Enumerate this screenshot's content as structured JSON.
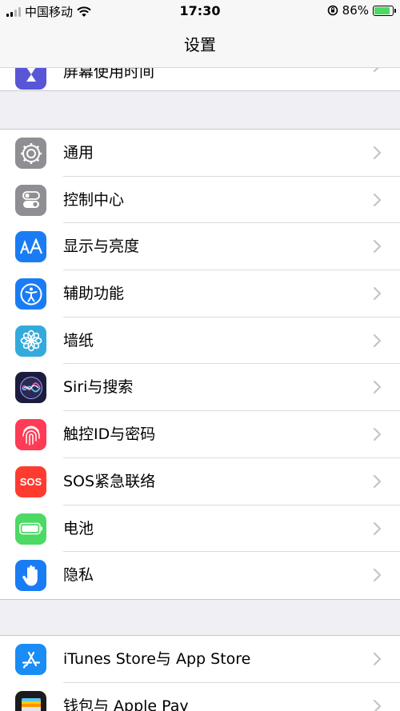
{
  "status": {
    "carrier": "中国移动",
    "time": "17:30",
    "battery": "86%",
    "battery_level": 0.86
  },
  "nav": {
    "title": "设置"
  },
  "partial": {
    "label": "屏幕使用时间",
    "icon": "hourglass-icon",
    "color": "#5856d6"
  },
  "group1": [
    {
      "label": "通用",
      "icon": "gear-icon",
      "color": "#8e8e93"
    },
    {
      "label": "控制中心",
      "icon": "toggles-icon",
      "color": "#8e8e93"
    },
    {
      "label": "显示与亮度",
      "icon": "text-size-icon",
      "color": "#1a7cf5"
    },
    {
      "label": "辅助功能",
      "icon": "accessibility-icon",
      "color": "#1a7cf5"
    },
    {
      "label": "墙纸",
      "icon": "flower-icon",
      "color": "#34aadc"
    },
    {
      "label": "Siri与搜索",
      "icon": "siri-icon",
      "color": "#1c1c3c"
    },
    {
      "label": "触控ID与密码",
      "icon": "fingerprint-icon",
      "color": "#ff3b55"
    },
    {
      "label": "SOS紧急联络",
      "icon": "sos-icon",
      "color": "#ff3b30",
      "text": "SOS"
    },
    {
      "label": "电池",
      "icon": "battery-icon",
      "color": "#4cd964"
    },
    {
      "label": "隐私",
      "icon": "hand-icon",
      "color": "#1a7cf5"
    }
  ],
  "group2": [
    {
      "label": "iTunes Store与 App Store",
      "icon": "app-store-icon",
      "color": "#1a8cf5"
    },
    {
      "label": "钱包与 Apple Pay",
      "icon": "wallet-icon",
      "color": "#1c1c1e"
    }
  ]
}
